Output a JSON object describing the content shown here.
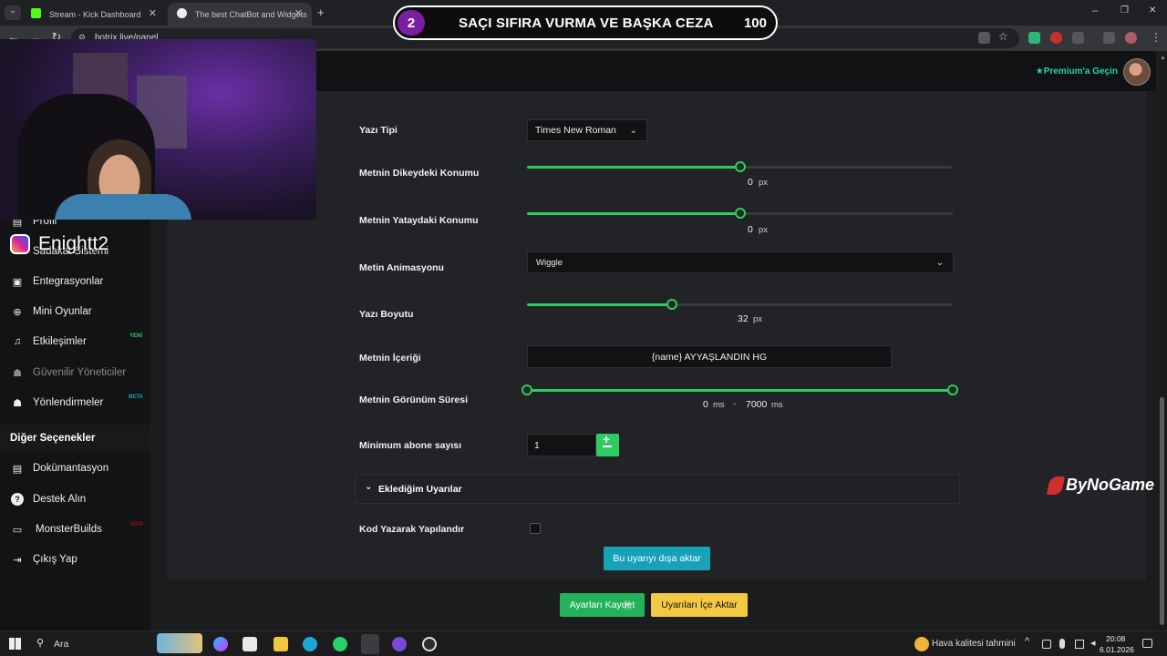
{
  "browser": {
    "tabs": [
      {
        "title": "Stream - Kick Dashboard"
      },
      {
        "title": "The best ChatBot and Widgets"
      }
    ],
    "new_tab": "+",
    "url": "botrix.live/panel",
    "window_controls": [
      "–",
      "❐",
      "✕"
    ]
  },
  "overlay": {
    "number": "2",
    "title": "SAÇI SIFIRA VURMA VE BAŞKA CEZA",
    "points": "100",
    "instagram_handle": "Enightt2",
    "sponsor": "ByNoGame"
  },
  "header": {
    "premium_label": "Premium'a Geçin"
  },
  "sidebar": {
    "items": [
      {
        "label": "Profil",
        "icon": "profile-icon"
      },
      {
        "label": "Sadakat Sistemi",
        "icon": "loyalty-icon"
      },
      {
        "label": "Entegrasyonlar",
        "icon": "integrations-icon"
      },
      {
        "label": "Mini Oyunlar",
        "icon": "gamepad-icon"
      },
      {
        "label": "Etkileşimler",
        "icon": "music-icon",
        "badge": "YENİ"
      },
      {
        "label": "Güvenilir Yöneticiler",
        "icon": "users-icon"
      },
      {
        "label": "Yönlendirmeler",
        "icon": "group-icon",
        "badge": "BETA"
      }
    ],
    "section_title": "Diğer Seçenekler",
    "other_items": [
      {
        "label": "Dokümantasyon",
        "icon": "docs-icon"
      },
      {
        "label": "Destek Alın",
        "icon": "help-icon"
      },
      {
        "label": "MonsterBuilds",
        "icon": "monitor-icon"
      },
      {
        "label": "Çıkış Yap",
        "icon": "logout-icon"
      }
    ]
  },
  "form": {
    "font_label": "Yazı Tipi",
    "font_value": "Times New Roman",
    "vertical_label": "Metnin Dikeydeki Konumu",
    "vertical_value": "0",
    "vertical_fraction": 0.5,
    "horizontal_label": "Metnin Yataydaki Konumu",
    "horizontal_value": "0",
    "horizontal_fraction": 0.5,
    "animation_label": "Metin Animasyonu",
    "animation_value": "Wiggle",
    "size_label": "Yazı Boyutu",
    "size_value": "32",
    "size_fraction": 0.34,
    "content_label": "Metnin İçeriği",
    "content_value": "{name} AYYAŞLANDIN HG",
    "duration_label": "Metnin Görünüm Süresi",
    "duration_min": "0",
    "duration_max": "7000",
    "duration_separator": "-",
    "min_subs_label": "Minimum abone sayısı",
    "min_subs_value": "1",
    "alerts_label": "Eklediğim Uyarılar",
    "code_label": "Kod Yazarak Yapılandır",
    "export_button": "Bu uyarıyı dışa aktar",
    "save_button": "Ayarları Kaydet",
    "import_button": "Uyarıları İçe Aktar",
    "unit_px": "px",
    "unit_ms": "ms"
  },
  "taskbar": {
    "search_label": "Ara",
    "weather_label": "Hava kalitesi tahmini",
    "time": "20:08",
    "date": "6.01.2026"
  },
  "colors": {
    "accent_green": "#2ecc60",
    "teal": "#17a2b8",
    "yellow": "#f5c842",
    "premium": "#27d3a4"
  }
}
